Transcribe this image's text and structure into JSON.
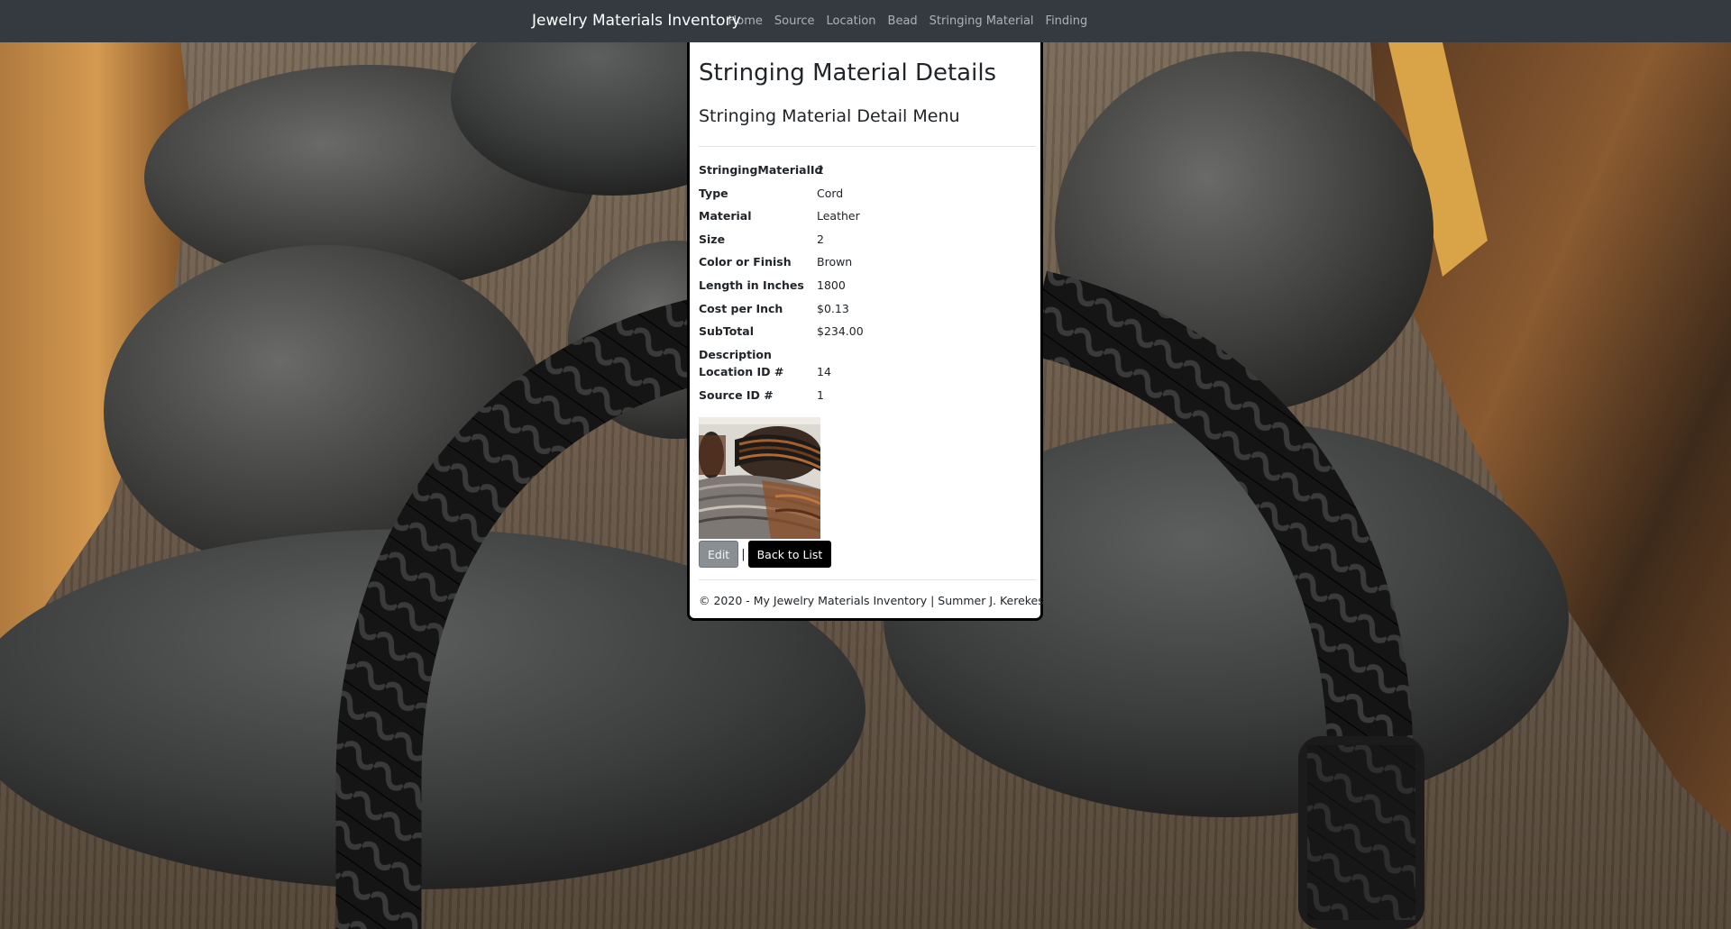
{
  "navbar": {
    "brand": "Jewelry Materials Inventory",
    "links": [
      "Home",
      "Source",
      "Location",
      "Bead",
      "Stringing Material",
      "Finding"
    ]
  },
  "page": {
    "title": "Stringing Material Details",
    "subtitle": "Stringing Material Detail Menu"
  },
  "details": [
    {
      "label": "StringingMaterialId",
      "value": "2"
    },
    {
      "label": "Type",
      "value": "Cord"
    },
    {
      "label": "Material",
      "value": "Leather"
    },
    {
      "label": "Size",
      "value": "2"
    },
    {
      "label": "Color or Finish",
      "value": "Brown"
    },
    {
      "label": "Length in Inches",
      "value": "1800"
    },
    {
      "label": "Cost per Inch",
      "value": "$0.13"
    },
    {
      "label": "SubTotal",
      "value": "$234.00"
    },
    {
      "label": "Description",
      "value": ""
    },
    {
      "label": "Location ID #",
      "value": "14"
    },
    {
      "label": "Source ID #",
      "value": "1"
    }
  ],
  "actions": {
    "edit": "Edit",
    "separator": "|",
    "back": "Back to List"
  },
  "footer": {
    "text": "© 2020 - My Jewelry Materials Inventory | Summer J. Kerekes"
  },
  "colors": {
    "navbar": "#343a40",
    "card_border": "#000000",
    "edit_button": "#8a8f94",
    "back_button": "#000000"
  }
}
